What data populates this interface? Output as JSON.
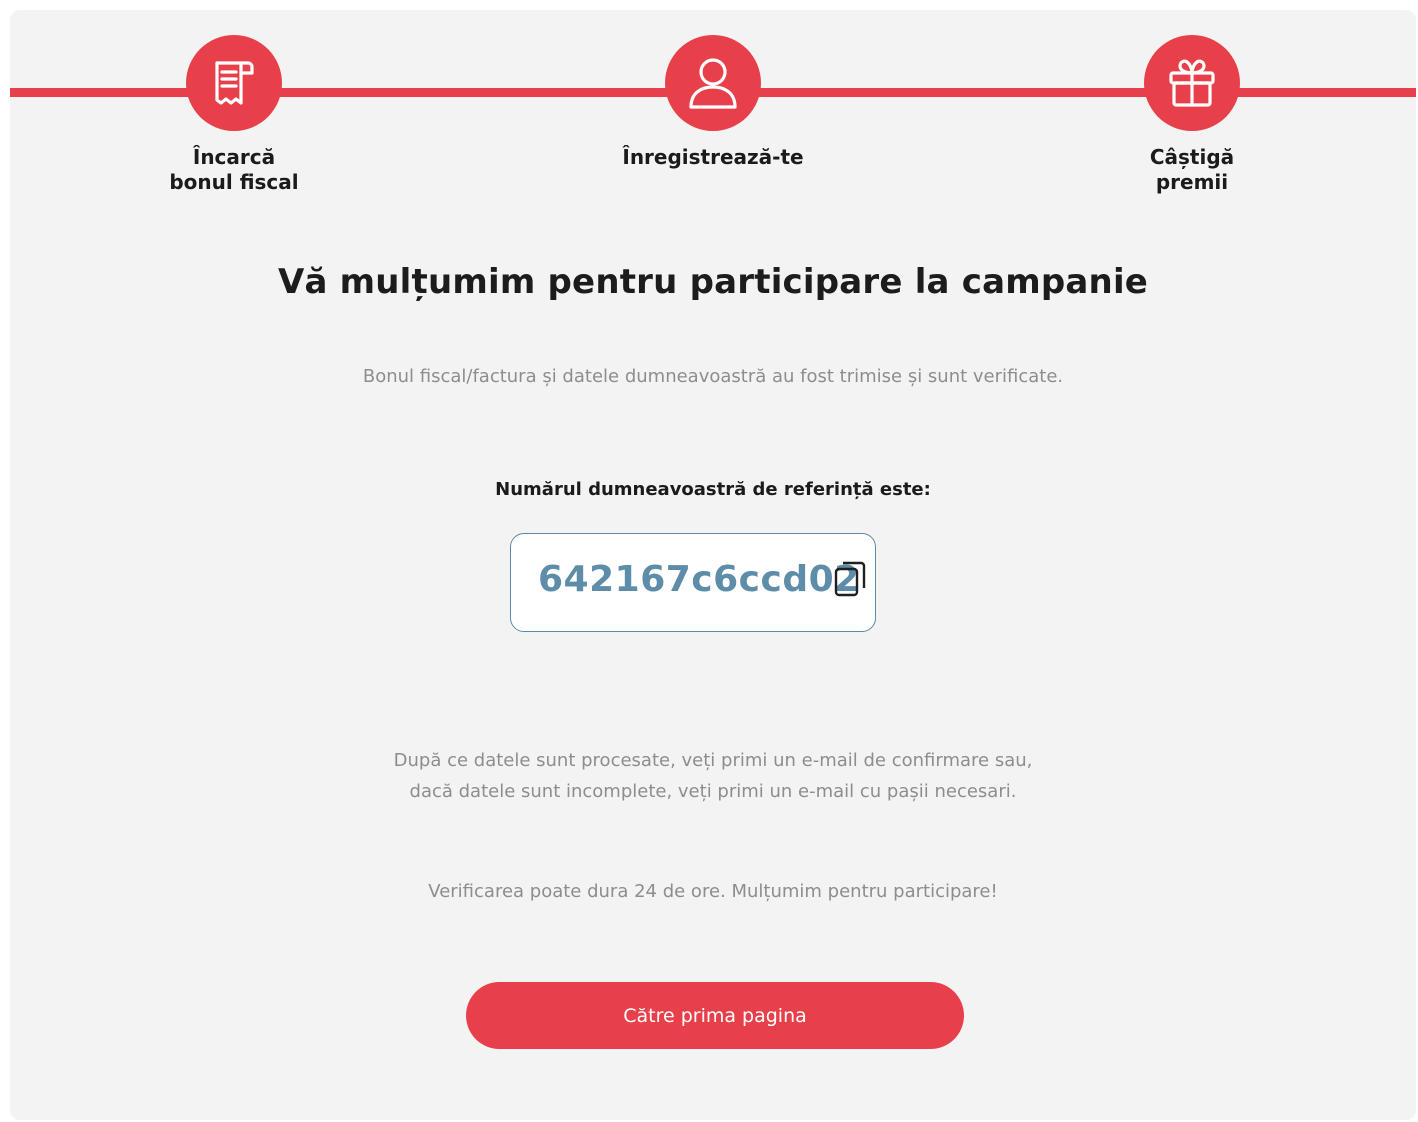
{
  "steps": [
    {
      "label": "Încarcă\nbonul fiscal",
      "icon": "receipt-icon"
    },
    {
      "label": "Înregistrează-te",
      "icon": "user-icon"
    },
    {
      "label": "Câștigă\npremii",
      "icon": "gift-icon"
    }
  ],
  "main": {
    "title": "Vă mulțumim pentru participare la campanie",
    "subtitle": "Bonul fiscal/factura și datele dumneavoastră au fost trimise și sunt verificate.",
    "reference_label": "Numărul dumneavoastră de referință este:",
    "reference_code": "642167c6ccd02",
    "copy_icon": "copy-icon",
    "info_line_1": "După ce datele sunt procesate, veți primi un e-mail de confirmare sau,",
    "info_line_2": "dacă datele sunt incomplete, veți primi un e-mail cu pașii necesari.",
    "info_line_3": "Verificarea poate dura 24 de ore. Mulțumim pentru participare!",
    "button_label": "Către prima pagina"
  },
  "colors": {
    "accent": "#e8404a",
    "reference": "#5e8da9",
    "background": "#f3f3f3"
  }
}
